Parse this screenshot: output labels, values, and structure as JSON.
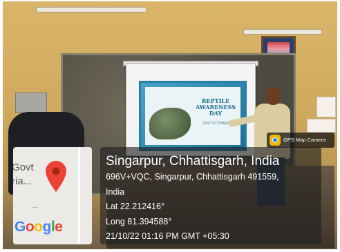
{
  "slide": {
    "title_line1": "REPTILE",
    "title_line2": "AWARENESS",
    "title_line3": "DAY",
    "date": "21ST OCTOBER"
  },
  "map": {
    "label_line1": "Govt",
    "label_line2": "ria...",
    "dots": "...",
    "brand": [
      "G",
      "o",
      "o",
      "g",
      "l",
      "e"
    ]
  },
  "overlay": {
    "badge": "GPS Map Camera",
    "place": "Singarpur, Chhattisgarh, India",
    "address_line1": "696V+VQC, Singarpur, Chhattisgarh 491559,",
    "address_line2": "India",
    "lat": "Lat 22.212416°",
    "long": "Long 81.394588°",
    "datetime": "21/10/22 01:16 PM GMT +05:30"
  },
  "colors": {
    "pin": "#ea4335",
    "overlay_bg": "#1e1e1e"
  }
}
